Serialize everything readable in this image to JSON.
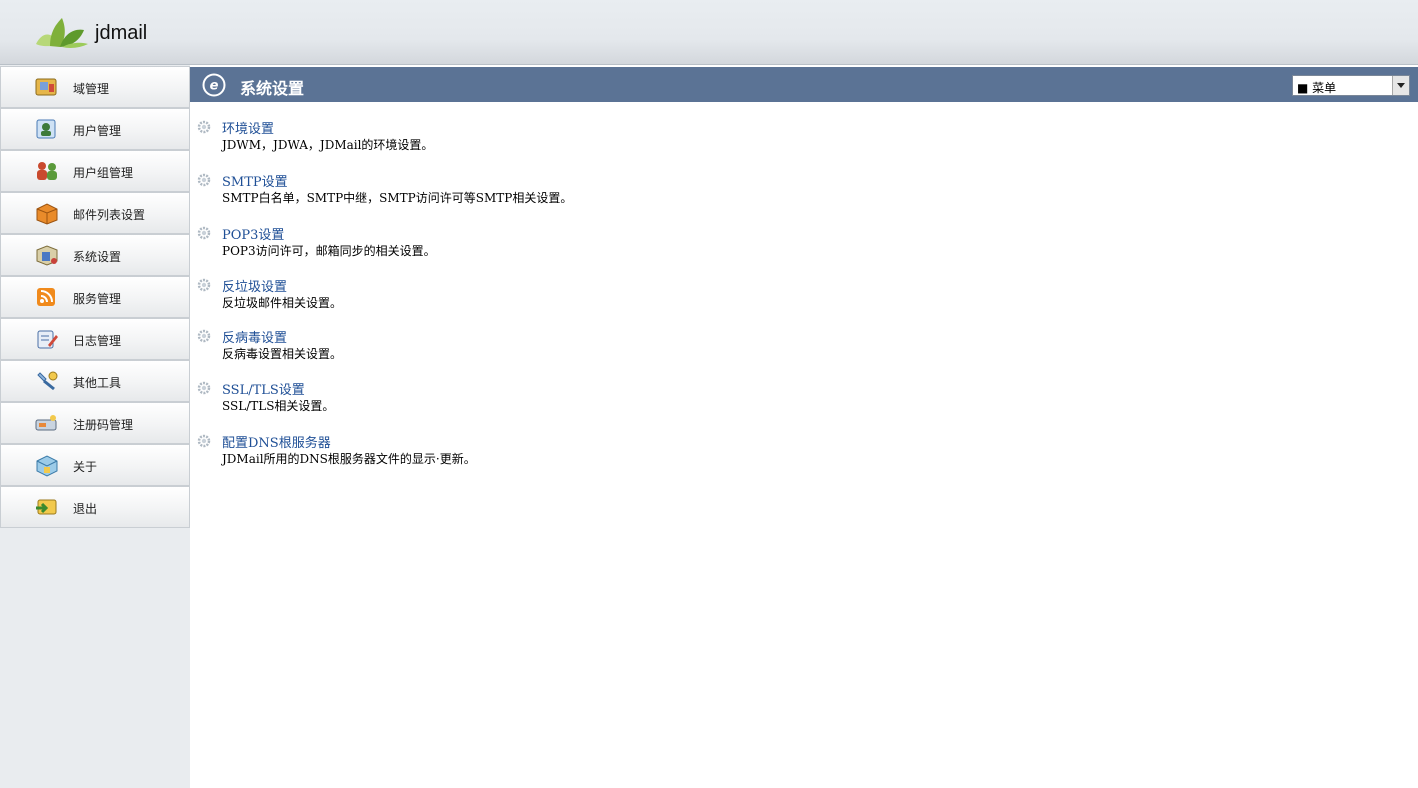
{
  "header": {
    "app_title": "jdmail"
  },
  "sidebar": {
    "items": [
      {
        "label": "域管理",
        "icon": "domain-icon"
      },
      {
        "label": "用户管理",
        "icon": "user-icon"
      },
      {
        "label": "用户组管理",
        "icon": "user-group-icon"
      },
      {
        "label": "邮件列表设置",
        "icon": "mail-list-icon"
      },
      {
        "label": "系统设置",
        "icon": "system-settings-icon"
      },
      {
        "label": "服务管理",
        "icon": "rss-service-icon"
      },
      {
        "label": "日志管理",
        "icon": "log-icon"
      },
      {
        "label": "其他工具",
        "icon": "tools-icon"
      },
      {
        "label": "注册码管理",
        "icon": "registration-icon"
      },
      {
        "label": "关于",
        "icon": "about-icon"
      },
      {
        "label": "退出",
        "icon": "logout-icon"
      }
    ]
  },
  "main": {
    "title": "系统设置",
    "menu_select": {
      "value": "■ 菜单"
    },
    "settings": [
      {
        "title": "环境设置",
        "desc": "JDWM，JDWA，JDMail的环境设置。"
      },
      {
        "title": "SMTP设置",
        "desc": "SMTP白名单，SMTP中继，SMTP访问许可等SMTP相关设置。"
      },
      {
        "title": "POP3设置",
        "desc": "POP3访问许可，邮箱同步的相关设置。"
      },
      {
        "title": "反垃圾设置",
        "desc": "反垃圾邮件相关设置。"
      },
      {
        "title": "反病毒设置",
        "desc": "反病毒设置相关设置。"
      },
      {
        "title": "SSL/TLS设置",
        "desc": "SSL/TLS相关设置。"
      },
      {
        "title": "配置DNS根服务器",
        "desc": "JDMail所用的DNS根服务器文件的显示·更新。"
      }
    ]
  },
  "colors": {
    "title_bar": "#5b7395",
    "link": "#1f4f96",
    "sidebar_bg": "#e9ecef"
  }
}
